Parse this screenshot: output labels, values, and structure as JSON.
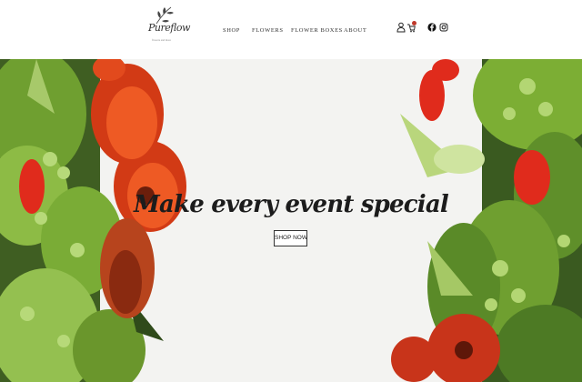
{
  "brand": {
    "name": "Pureflow",
    "tagline": "flowers and more"
  },
  "nav": [
    {
      "label": "SHOP"
    },
    {
      "label": "FLOWERS"
    },
    {
      "label": "FLOWER BOXES"
    },
    {
      "label": "ABOUT"
    }
  ],
  "header_icons": [
    "user-icon",
    "cart-icon",
    "facebook-icon",
    "instagram-icon"
  ],
  "hero": {
    "headline": "Make every event special",
    "cta_label": "SHOP NOW"
  },
  "colors": {
    "background": "#f3f3f1",
    "accent_red": "#e0401e",
    "leaf_green": "#7fb33a",
    "badge": "#c0392b"
  }
}
